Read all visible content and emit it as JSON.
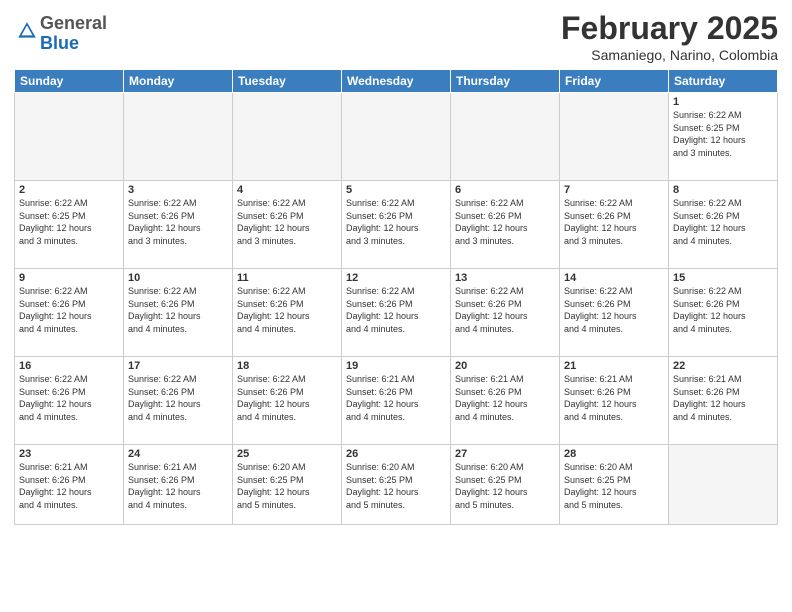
{
  "logo": {
    "general": "General",
    "blue": "Blue"
  },
  "title": "February 2025",
  "location": "Samaniego, Narino, Colombia",
  "weekdays": [
    "Sunday",
    "Monday",
    "Tuesday",
    "Wednesday",
    "Thursday",
    "Friday",
    "Saturday"
  ],
  "weeks": [
    [
      {
        "day": "",
        "info": ""
      },
      {
        "day": "",
        "info": ""
      },
      {
        "day": "",
        "info": ""
      },
      {
        "day": "",
        "info": ""
      },
      {
        "day": "",
        "info": ""
      },
      {
        "day": "",
        "info": ""
      },
      {
        "day": "1",
        "info": "Sunrise: 6:22 AM\nSunset: 6:25 PM\nDaylight: 12 hours\nand 3 minutes."
      }
    ],
    [
      {
        "day": "2",
        "info": "Sunrise: 6:22 AM\nSunset: 6:25 PM\nDaylight: 12 hours\nand 3 minutes."
      },
      {
        "day": "3",
        "info": "Sunrise: 6:22 AM\nSunset: 6:26 PM\nDaylight: 12 hours\nand 3 minutes."
      },
      {
        "day": "4",
        "info": "Sunrise: 6:22 AM\nSunset: 6:26 PM\nDaylight: 12 hours\nand 3 minutes."
      },
      {
        "day": "5",
        "info": "Sunrise: 6:22 AM\nSunset: 6:26 PM\nDaylight: 12 hours\nand 3 minutes."
      },
      {
        "day": "6",
        "info": "Sunrise: 6:22 AM\nSunset: 6:26 PM\nDaylight: 12 hours\nand 3 minutes."
      },
      {
        "day": "7",
        "info": "Sunrise: 6:22 AM\nSunset: 6:26 PM\nDaylight: 12 hours\nand 3 minutes."
      },
      {
        "day": "8",
        "info": "Sunrise: 6:22 AM\nSunset: 6:26 PM\nDaylight: 12 hours\nand 4 minutes."
      }
    ],
    [
      {
        "day": "9",
        "info": "Sunrise: 6:22 AM\nSunset: 6:26 PM\nDaylight: 12 hours\nand 4 minutes."
      },
      {
        "day": "10",
        "info": "Sunrise: 6:22 AM\nSunset: 6:26 PM\nDaylight: 12 hours\nand 4 minutes."
      },
      {
        "day": "11",
        "info": "Sunrise: 6:22 AM\nSunset: 6:26 PM\nDaylight: 12 hours\nand 4 minutes."
      },
      {
        "day": "12",
        "info": "Sunrise: 6:22 AM\nSunset: 6:26 PM\nDaylight: 12 hours\nand 4 minutes."
      },
      {
        "day": "13",
        "info": "Sunrise: 6:22 AM\nSunset: 6:26 PM\nDaylight: 12 hours\nand 4 minutes."
      },
      {
        "day": "14",
        "info": "Sunrise: 6:22 AM\nSunset: 6:26 PM\nDaylight: 12 hours\nand 4 minutes."
      },
      {
        "day": "15",
        "info": "Sunrise: 6:22 AM\nSunset: 6:26 PM\nDaylight: 12 hours\nand 4 minutes."
      }
    ],
    [
      {
        "day": "16",
        "info": "Sunrise: 6:22 AM\nSunset: 6:26 PM\nDaylight: 12 hours\nand 4 minutes."
      },
      {
        "day": "17",
        "info": "Sunrise: 6:22 AM\nSunset: 6:26 PM\nDaylight: 12 hours\nand 4 minutes."
      },
      {
        "day": "18",
        "info": "Sunrise: 6:22 AM\nSunset: 6:26 PM\nDaylight: 12 hours\nand 4 minutes."
      },
      {
        "day": "19",
        "info": "Sunrise: 6:21 AM\nSunset: 6:26 PM\nDaylight: 12 hours\nand 4 minutes."
      },
      {
        "day": "20",
        "info": "Sunrise: 6:21 AM\nSunset: 6:26 PM\nDaylight: 12 hours\nand 4 minutes."
      },
      {
        "day": "21",
        "info": "Sunrise: 6:21 AM\nSunset: 6:26 PM\nDaylight: 12 hours\nand 4 minutes."
      },
      {
        "day": "22",
        "info": "Sunrise: 6:21 AM\nSunset: 6:26 PM\nDaylight: 12 hours\nand 4 minutes."
      }
    ],
    [
      {
        "day": "23",
        "info": "Sunrise: 6:21 AM\nSunset: 6:26 PM\nDaylight: 12 hours\nand 4 minutes."
      },
      {
        "day": "24",
        "info": "Sunrise: 6:21 AM\nSunset: 6:26 PM\nDaylight: 12 hours\nand 4 minutes."
      },
      {
        "day": "25",
        "info": "Sunrise: 6:20 AM\nSunset: 6:25 PM\nDaylight: 12 hours\nand 5 minutes."
      },
      {
        "day": "26",
        "info": "Sunrise: 6:20 AM\nSunset: 6:25 PM\nDaylight: 12 hours\nand 5 minutes."
      },
      {
        "day": "27",
        "info": "Sunrise: 6:20 AM\nSunset: 6:25 PM\nDaylight: 12 hours\nand 5 minutes."
      },
      {
        "day": "28",
        "info": "Sunrise: 6:20 AM\nSunset: 6:25 PM\nDaylight: 12 hours\nand 5 minutes."
      },
      {
        "day": "",
        "info": ""
      }
    ]
  ]
}
